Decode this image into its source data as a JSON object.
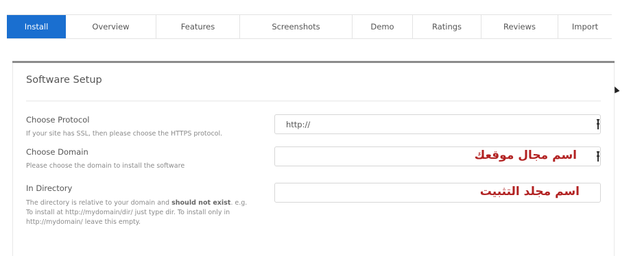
{
  "tabs": [
    {
      "label": "Install",
      "active": true
    },
    {
      "label": "Overview"
    },
    {
      "label": "Features"
    },
    {
      "label": "Screenshots"
    },
    {
      "label": "Demo"
    },
    {
      "label": "Ratings"
    },
    {
      "label": "Reviews"
    },
    {
      "label": "Import"
    }
  ],
  "section": {
    "title": "Software Setup"
  },
  "protocol": {
    "label": "Choose Protocol",
    "help": "If your site has SSL, then please choose the HTTPS protocol.",
    "value": "http://"
  },
  "domain": {
    "label": "Choose Domain",
    "help": "Please choose the domain to install the software",
    "value": "اسم مجال موقعك"
  },
  "directory": {
    "label": "In Directory",
    "help_part1": "The directory is relative to your domain and ",
    "help_bold": "should not exist",
    "help_part2": ". e.g. To install at http://mydomain/dir/ just type dir. To install only in http://mydomain/ leave this empty.",
    "value": "اسم مجلد التثبيت"
  },
  "colors": {
    "accent": "#1a6fd0",
    "annotation": "#b22222"
  }
}
